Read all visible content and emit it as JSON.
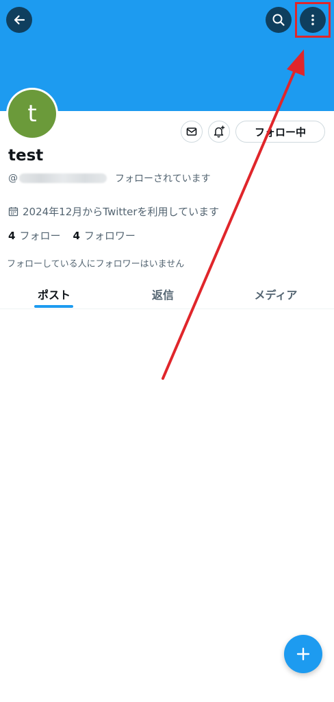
{
  "profile": {
    "avatar_letter": "t",
    "display_name": "test",
    "handle_prefix": "@",
    "follows_you": "フォローされています",
    "joined": "2024年12月からTwitterを利用しています",
    "following_count": "4",
    "following_label": "フォロー",
    "followers_count": "4",
    "followers_label": "フォロワー",
    "mutuals_note": "フォローしている人にフォロワーはいません"
  },
  "actions": {
    "follow_button_label": "フォロー中"
  },
  "tabs": [
    {
      "label": "ポスト",
      "active": true
    },
    {
      "label": "返信",
      "active": false
    },
    {
      "label": "メディア",
      "active": false
    }
  ],
  "icons": {
    "back": "arrow-left-icon",
    "search": "search-icon",
    "more": "more-vertical-icon",
    "message": "envelope-icon",
    "notify": "bell-plus-icon",
    "calendar": "calendar-icon",
    "compose": "plus-icon"
  },
  "colors": {
    "banner": "#1d9bf0",
    "header_button": "#0f3f5e",
    "avatar": "#6b9a3a",
    "accent": "#1d9bf0",
    "annotation": "#e0262b"
  }
}
